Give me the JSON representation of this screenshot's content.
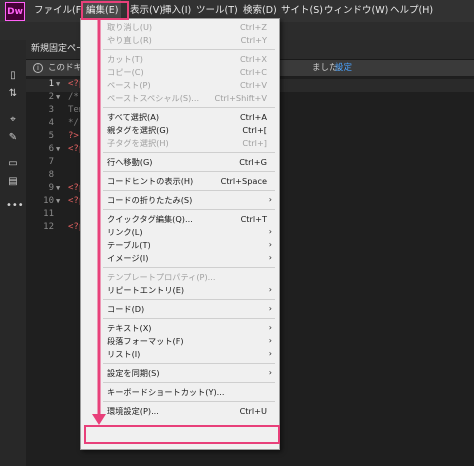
{
  "app": {
    "logo": "Dw",
    "menubar": [
      "ファイル(F)",
      "編集(E)",
      "表示(V)",
      "挿入(I)",
      "ツール(T)",
      "検索(D)",
      "サイト(S)",
      "ウィンドウ(W)",
      "ヘルプ(H)"
    ]
  },
  "document": {
    "tab_label": "新規固定ページ",
    "info_text": "このドキュメ",
    "info_tail": "ました。",
    "info_link": "設定"
  },
  "editor": {
    "lines": [
      {
        "num": "1",
        "fold": "▼",
        "text": "<?p"
      },
      {
        "num": "2",
        "fold": "▼",
        "text": "/*"
      },
      {
        "num": "3",
        "fold": "",
        "text": "Tem"
      },
      {
        "num": "4",
        "fold": "",
        "text": "*/"
      },
      {
        "num": "5",
        "fold": "",
        "text": "?>"
      },
      {
        "num": "6",
        "fold": "▼",
        "text": "<?p"
      },
      {
        "num": "7",
        "fold": "",
        "text": ""
      },
      {
        "num": "8",
        "fold": "",
        "text": ""
      },
      {
        "num": "9",
        "fold": "▼",
        "text": "<?p"
      },
      {
        "num": "10",
        "fold": "▼",
        "text": "<?p"
      },
      {
        "num": "11",
        "fold": "",
        "text": ""
      },
      {
        "num": "12",
        "fold": "",
        "text": "<?p"
      }
    ]
  },
  "menu": {
    "items": [
      {
        "label": "取り消し(U)",
        "shortcut": "Ctrl+Z",
        "disabled": true
      },
      {
        "label": "やり直し(R)",
        "shortcut": "Ctrl+Y",
        "disabled": true
      },
      {
        "label": "カット(T)",
        "shortcut": "Ctrl+X",
        "disabled": true
      },
      {
        "label": "コピー(C)",
        "shortcut": "Ctrl+C",
        "disabled": true
      },
      {
        "label": "ペースト(P)",
        "shortcut": "Ctrl+V",
        "disabled": true
      },
      {
        "label": "ペーストスペシャル(S)...",
        "shortcut": "Ctrl+Shift+V",
        "disabled": true
      },
      {
        "label": "すべて選択(A)",
        "shortcut": "Ctrl+A",
        "disabled": false
      },
      {
        "label": "親タグを選択(G)",
        "shortcut": "Ctrl+[",
        "disabled": false
      },
      {
        "label": "子タグを選択(H)",
        "shortcut": "Ctrl+]",
        "disabled": true
      },
      {
        "label": "行へ移動(G)",
        "shortcut": "Ctrl+G",
        "disabled": false
      },
      {
        "label": "コードヒントの表示(H)",
        "shortcut": "Ctrl+Space",
        "disabled": false
      },
      {
        "label": "コードの折りたたみ(S)",
        "shortcut": "",
        "submenu": true,
        "disabled": false
      },
      {
        "label": "クイックタグ編集(Q)...",
        "shortcut": "Ctrl+T",
        "disabled": false
      },
      {
        "label": "リンク(L)",
        "shortcut": "",
        "submenu": true,
        "disabled": false
      },
      {
        "label": "テーブル(T)",
        "shortcut": "",
        "submenu": true,
        "disabled": false
      },
      {
        "label": "イメージ(I)",
        "shortcut": "",
        "submenu": true,
        "disabled": false
      },
      {
        "label": "テンプレートプロパティ(P)...",
        "shortcut": "",
        "disabled": true
      },
      {
        "label": "リピートエントリ(E)",
        "shortcut": "",
        "submenu": true,
        "disabled": false
      },
      {
        "label": "コード(D)",
        "shortcut": "",
        "submenu": true,
        "disabled": false
      },
      {
        "label": "テキスト(X)",
        "shortcut": "",
        "submenu": true,
        "disabled": false
      },
      {
        "label": "段落フォーマット(F)",
        "shortcut": "",
        "submenu": true,
        "disabled": false
      },
      {
        "label": "リスト(I)",
        "shortcut": "",
        "submenu": true,
        "disabled": false
      },
      {
        "label": "設定を同期(S)",
        "shortcut": "",
        "submenu": true,
        "disabled": false
      },
      {
        "label": "キーボードショートカット(Y)...",
        "shortcut": "",
        "disabled": false
      },
      {
        "label": "環境設定(P)...",
        "shortcut": "Ctrl+U",
        "disabled": false
      }
    ]
  },
  "colors": {
    "highlight": "#e8407a",
    "logo_bg": "#470137",
    "logo_fg": "#ff61f6"
  }
}
